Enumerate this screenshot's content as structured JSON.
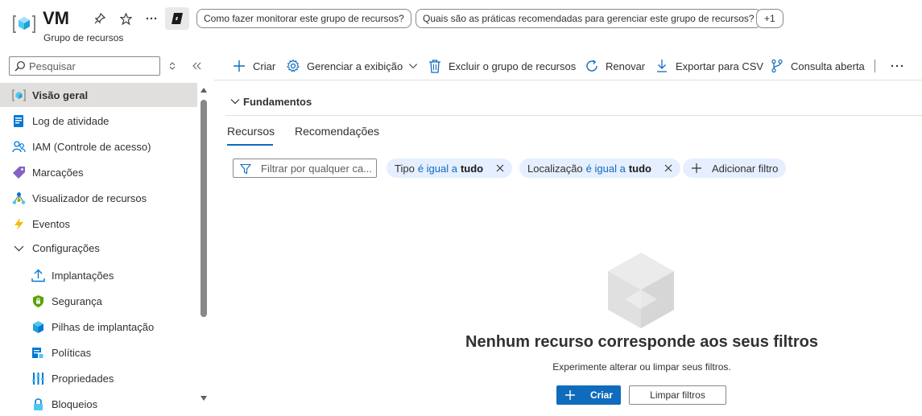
{
  "header": {
    "title": "VM",
    "subtitle": "Grupo de recursos",
    "suggestions": [
      "Como fazer monitorar este grupo de recursos?",
      "Quais são as práticas recomendadas para gerenciar este grupo de recursos?"
    ],
    "more_suggestions": "+1"
  },
  "sidebar": {
    "search_placeholder": "Pesquisar",
    "items": [
      {
        "label": "Visão geral",
        "icon": "resource-group-icon",
        "active": true
      },
      {
        "label": "Log de atividade",
        "icon": "activity-log-icon"
      },
      {
        "label": "IAM (Controle de acesso)",
        "icon": "people-icon"
      },
      {
        "label": "Marcações",
        "icon": "tag-icon"
      },
      {
        "label": "Visualizador de recursos",
        "icon": "resource-visualizer-icon"
      },
      {
        "label": "Eventos",
        "icon": "lightning-icon"
      },
      {
        "label": "Configurações",
        "icon": "chevron-down-icon",
        "group": true
      },
      {
        "label": "Implantações",
        "icon": "upload-icon"
      },
      {
        "label": "Segurança",
        "icon": "shield-icon"
      },
      {
        "label": "Pilhas de implantação",
        "icon": "cube-stack-icon"
      },
      {
        "label": "Políticas",
        "icon": "policy-icon"
      },
      {
        "label": "Propriedades",
        "icon": "properties-icon"
      },
      {
        "label": "Bloqueios",
        "icon": "lock-icon"
      }
    ]
  },
  "toolbar": {
    "create": "Criar",
    "manage_view": "Gerenciar a exibição",
    "delete_rg": "Excluir o grupo de recursos",
    "refresh": "Renovar",
    "export_csv": "Exportar para CSV",
    "open_query": "Consulta aberta"
  },
  "fundamentals": "Fundamentos",
  "tabs": [
    {
      "label": "Recursos",
      "active": true
    },
    {
      "label": "Recomendações",
      "active": false
    }
  ],
  "filters": {
    "placeholder": "Filtrar por qualquer ca...",
    "chips": [
      {
        "field": "Tipo",
        "op": "é igual a",
        "value": "tudo"
      },
      {
        "field": "Localização",
        "op": "é igual a",
        "value": "tudo"
      }
    ],
    "add_filter": "Adicionar filtro"
  },
  "empty_state": {
    "title": "Nenhum recurso corresponde aos seus filtros",
    "subtitle": "Experimente alterar ou limpar seus filtros.",
    "create_button": "Criar",
    "clear_button": "Limpar filtros"
  },
  "colors": {
    "accent": "#0f6cbd",
    "chip_bg": "#e5efff",
    "active_nav_bg": "#e1dfdd"
  }
}
